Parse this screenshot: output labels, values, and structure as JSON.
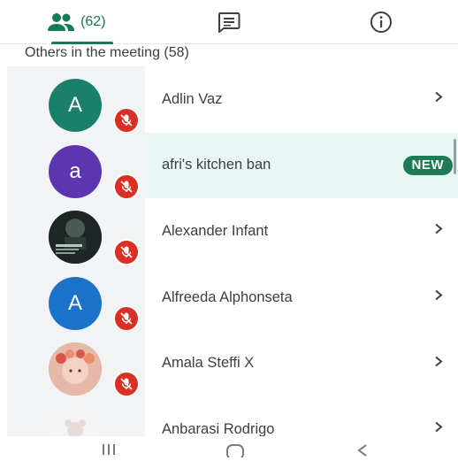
{
  "tabs": [
    {
      "icon": "people-icon",
      "count": "(62)",
      "active": true
    },
    {
      "icon": "chat-icon",
      "active": false
    },
    {
      "icon": "info-icon",
      "active": false
    }
  ],
  "section": {
    "title": "Others in the meeting (58)"
  },
  "participants": [
    {
      "name": "Adlin Vaz",
      "initial": "A",
      "avatar_color": "#1a7f6b",
      "muted": true,
      "badge": ""
    },
    {
      "name": "afri's kitchen ban",
      "initial": "a",
      "avatar_color": "#5e35b1",
      "muted": true,
      "badge": "NEW"
    },
    {
      "name": "Alexander Infant",
      "initial": "",
      "avatar_color": "#1f2a2a",
      "muted": true,
      "badge": ""
    },
    {
      "name": "Alfreeda Alphonseta",
      "initial": "A",
      "avatar_color": "#1a73c8",
      "muted": true,
      "badge": ""
    },
    {
      "name": "Amala Steffi X",
      "initial": "",
      "avatar_color": "#d9a79a",
      "muted": true,
      "badge": ""
    },
    {
      "name": "Anbarasi Rodrigo",
      "initial": "",
      "avatar_color": "#f2f2f2",
      "muted": false,
      "badge": ""
    }
  ],
  "colors": {
    "accent": "#137a5a",
    "mute_red": "#d93025",
    "highlight": "#e9f6f4"
  },
  "nav": {
    "icons": [
      "recents-icon",
      "home-icon",
      "back-icon"
    ]
  }
}
